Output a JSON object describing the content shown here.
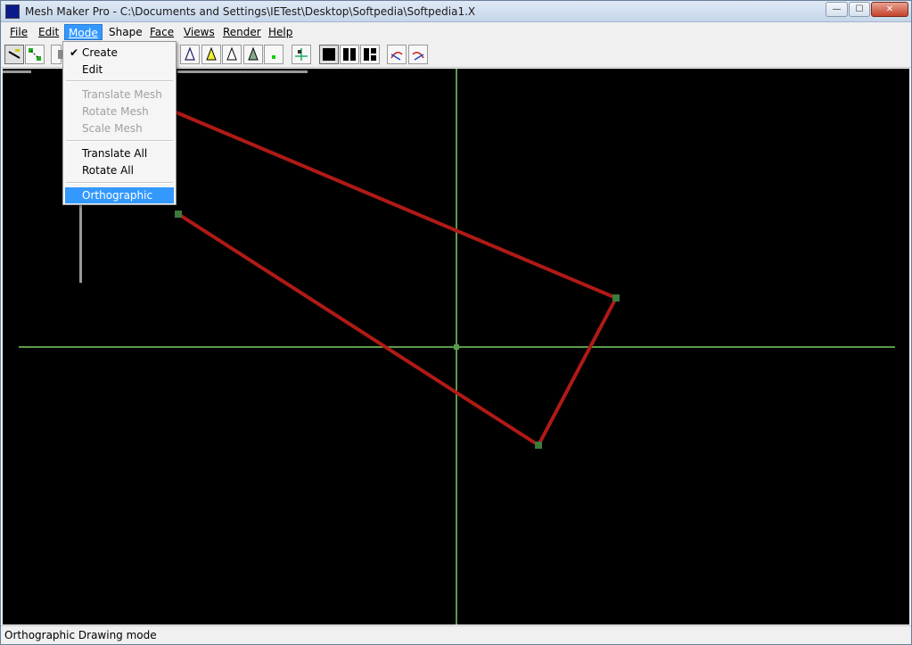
{
  "window": {
    "title": "Mesh Maker Pro -  C:\\Documents and Settings\\IETest\\Desktop\\Softpedia\\Softpedia1.X",
    "minimize": "—",
    "maximize": "☐",
    "close": "✕"
  },
  "menubar": {
    "items": [
      {
        "label": "File"
      },
      {
        "label": "Edit"
      },
      {
        "label": "Mode"
      },
      {
        "label": "Shape"
      },
      {
        "label": "Face"
      },
      {
        "label": "Views"
      },
      {
        "label": "Render"
      },
      {
        "label": "Help"
      }
    ],
    "active": "Mode"
  },
  "mode_menu": {
    "items": [
      {
        "label": "Create",
        "checked": true,
        "enabled": true
      },
      {
        "label": "Edit",
        "checked": false,
        "enabled": true
      },
      {
        "label": "Translate Mesh",
        "enabled": false
      },
      {
        "label": "Rotate Mesh",
        "enabled": false
      },
      {
        "label": "Scale Mesh",
        "enabled": false
      },
      {
        "label": "Translate All",
        "enabled": true
      },
      {
        "label": "Rotate All",
        "enabled": true
      },
      {
        "label": "Orthographic",
        "enabled": true,
        "highlighted": true
      }
    ],
    "check_glyph": "✔"
  },
  "toolbar": {
    "icons": [
      "draw-line-icon",
      "select-points-icon",
      "gray-tool-icon",
      "vertex-triangle-icon",
      "yellow-triangle-icon",
      "outline-triangle-icon",
      "filled-triangle-icon",
      "green-point-icon",
      "axis-move-icon",
      "single-view-icon",
      "dual-view-icon",
      "quad-view-icon",
      "rotate-left-icon",
      "rotate-right-icon"
    ]
  },
  "statusbar": {
    "text": "Orthographic Drawing mode"
  },
  "colors": {
    "viewport_bg": "#000000",
    "axis": "#5a9a4a",
    "mesh_edge": "#b01a16",
    "vertex": "#3a7a3a",
    "menu_highlight": "#3399ff"
  }
}
